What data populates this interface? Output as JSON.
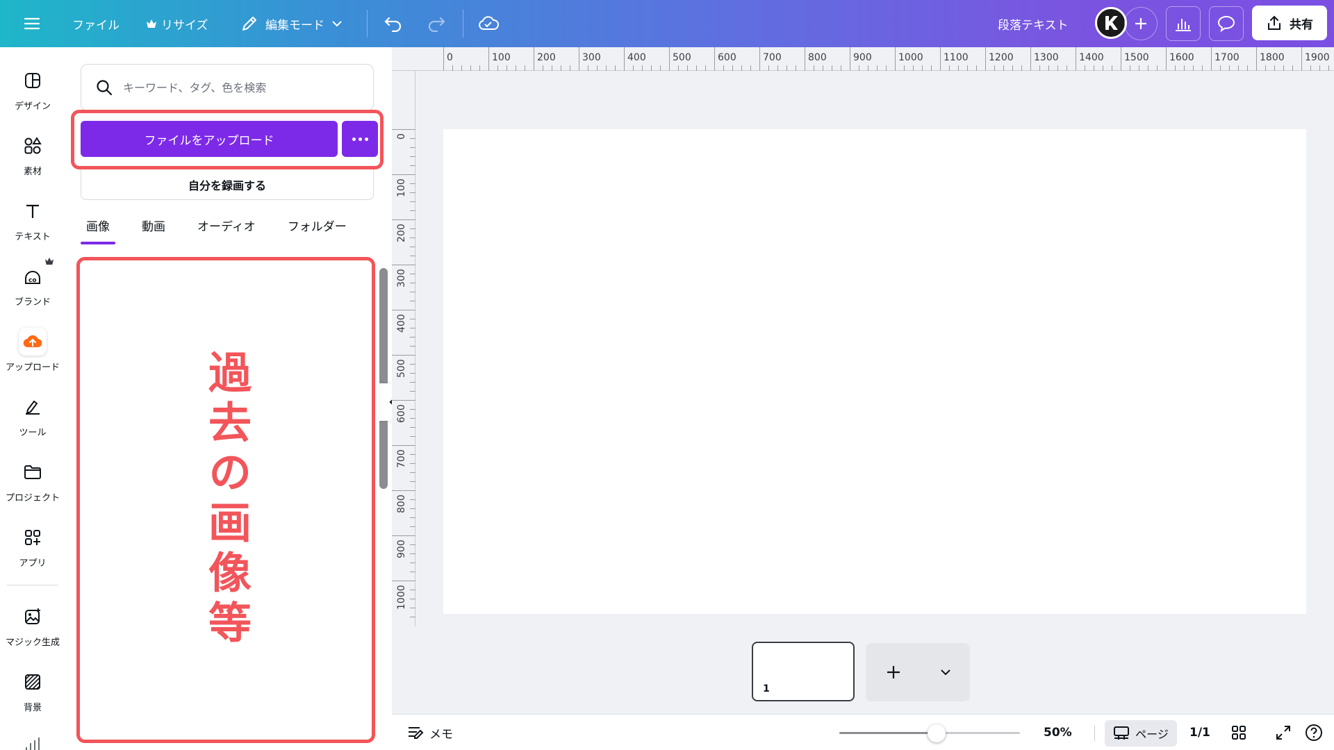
{
  "topbar": {
    "menu_icon": "hamburger-icon",
    "file_label": "ファイル",
    "resize_label": "リサイズ",
    "edit_mode_label": "編集モード",
    "paragraph_text_label": "段落テキスト",
    "share_label": "共有"
  },
  "rail": {
    "items": [
      {
        "label": "デザイン",
        "icon": "layout-icon"
      },
      {
        "label": "素材",
        "icon": "shapes-icon"
      },
      {
        "label": "テキスト",
        "icon": "text-icon"
      },
      {
        "label": "ブランド",
        "icon": "brand-icon"
      },
      {
        "label": "アップロード",
        "icon": "upload-cloud-icon"
      },
      {
        "label": "ツール",
        "icon": "pen-tool-icon"
      },
      {
        "label": "プロジェクト",
        "icon": "folder-icon"
      },
      {
        "label": "アプリ",
        "icon": "apps-icon"
      },
      {
        "label": "マジック生成",
        "icon": "magic-image-icon"
      },
      {
        "label": "背景",
        "icon": "background-pattern-icon"
      }
    ]
  },
  "panel": {
    "search_placeholder": "キーワード、タグ、色を検索",
    "upload_label": "ファイルをアップロード",
    "record_label": "自分を録画する",
    "tabs": [
      "画像",
      "動画",
      "オーディオ",
      "フォルダー"
    ],
    "annotation_text": "過去の画像等"
  },
  "ruler": {
    "h_labels": [
      "0",
      "100",
      "200",
      "300",
      "400",
      "500",
      "600",
      "700",
      "800",
      "900",
      "1000",
      "1100",
      "1200",
      "1300",
      "1400",
      "1500",
      "1600",
      "1700",
      "1800",
      "1900"
    ],
    "v_labels": [
      "0",
      "100",
      "200",
      "300",
      "400",
      "500",
      "600",
      "700",
      "800",
      "900",
      "1000"
    ]
  },
  "pages": {
    "thumb_number": "1"
  },
  "footer": {
    "notes_label": "メモ",
    "zoom": "50%",
    "zoom_fraction": 0.5,
    "page_label": "ページ",
    "page_count": "1/1"
  },
  "colors": {
    "accent": "#7d2ae8",
    "highlight": "#f2555a",
    "upload_icon": "#ff6a13"
  }
}
